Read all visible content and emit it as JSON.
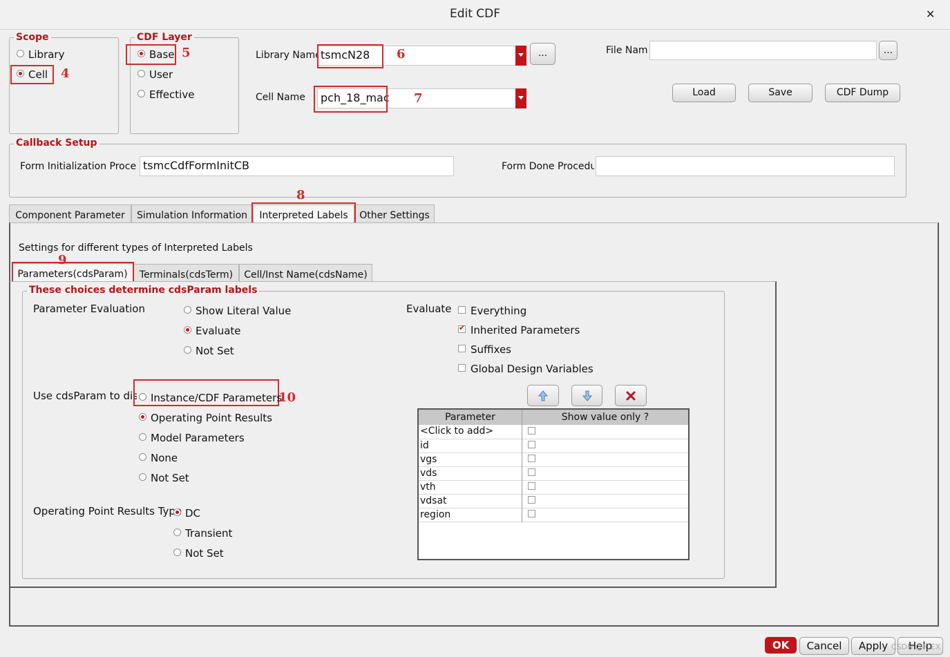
{
  "window": {
    "title": "Edit CDF",
    "close_icon": "close-icon"
  },
  "scope": {
    "legend": "Scope",
    "options": [
      "Library",
      "Cell"
    ],
    "selected": "Cell"
  },
  "cdf_layer": {
    "legend": "CDF Layer",
    "options": [
      "Base",
      "User",
      "Effective"
    ],
    "selected": "Base"
  },
  "library": {
    "label": "Library Name",
    "value": "tsmcN28",
    "browse_label": "..."
  },
  "cell": {
    "label": "Cell Name",
    "value": "pch_18_mac"
  },
  "file": {
    "label": "File Nam",
    "value": "",
    "browse_label": "..."
  },
  "file_buttons": {
    "load": "Load",
    "save": "Save",
    "dump": "CDF Dump"
  },
  "callback": {
    "legend": "Callback Setup",
    "init_label": "Form Initialization Proce",
    "init_value": "tsmcCdfFormInitCB",
    "done_label": "Form Done Procedu",
    "done_value": ""
  },
  "main_tabs": [
    "Component Parameter",
    "Simulation Information",
    "Interpreted Labels",
    "Other Settings"
  ],
  "active_main_tab": "Interpreted Labels",
  "interp": {
    "heading": "Settings for different types of Interpreted Labels",
    "sub_tabs": [
      "Parameters(cdsParam)",
      "Terminals(cdsTerm)",
      "Cell/Inst Name(cdsName)"
    ],
    "active_sub_tab": "Parameters(cdsParam)",
    "group_legend": "These choices determine cdsParam labels",
    "param_eval": {
      "label": "Parameter Evaluation",
      "options": [
        "Show Literal Value",
        "Evaluate",
        "Not Set"
      ],
      "selected": "Evaluate"
    },
    "evaluate": {
      "label": "Evaluate",
      "options": [
        {
          "label": "Everything",
          "checked": false
        },
        {
          "label": "Inherited Parameters",
          "checked": true
        },
        {
          "label": "Suffixes",
          "checked": false
        },
        {
          "label": "Global Design Variables",
          "checked": false
        }
      ]
    },
    "use_cdsparam": {
      "label": "Use cdsParam to disp",
      "options": [
        "Instance/CDF Parameters",
        "Operating Point Results",
        "Model Parameters",
        "None",
        "Not Set"
      ],
      "selected": "Operating Point Results"
    },
    "op_type": {
      "label": "Operating Point Results Type",
      "options": [
        "DC",
        "Transient",
        "Not Set"
      ],
      "selected": "DC"
    },
    "table": {
      "col_parameter": "Parameter",
      "col_show": "Show value only ?",
      "rows": [
        {
          "name": "<Click to add>",
          "show": false
        },
        {
          "name": "id",
          "show": false
        },
        {
          "name": "vgs",
          "show": false
        },
        {
          "name": "vds",
          "show": false
        },
        {
          "name": "vth",
          "show": false
        },
        {
          "name": "vdsat",
          "show": false
        },
        {
          "name": "region",
          "show": false
        }
      ],
      "tool_icons": [
        "arrow-up-icon",
        "arrow-down-icon",
        "delete-x-icon"
      ]
    }
  },
  "annotations": [
    "4",
    "5",
    "6",
    "7",
    "8",
    "9",
    "10"
  ],
  "footer": {
    "ok": "OK",
    "cancel": "Cancel",
    "apply": "Apply",
    "help": "Help",
    "watermark": "CSDN @ICEX"
  },
  "colors": {
    "accent_red": "#c0141b",
    "annotation_red": "#d42a2a",
    "legend_red": "#b01818"
  }
}
